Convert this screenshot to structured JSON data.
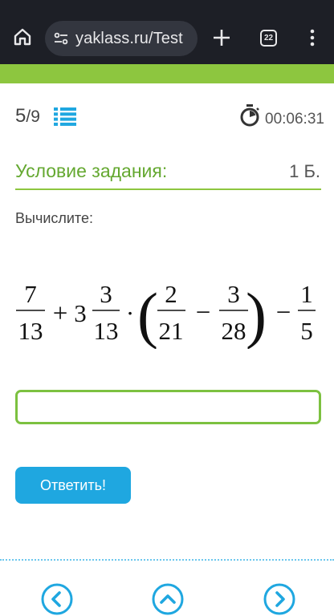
{
  "browser": {
    "url": "yaklass.ru/Test",
    "tab_count": "22",
    "icons": [
      "home-icon",
      "site-settings-icon",
      "plus-icon",
      "tabs-icon",
      "more-vert-icon"
    ]
  },
  "header": {
    "current": "5",
    "total": "/9",
    "timer": "00:06:31"
  },
  "task": {
    "title": "Условие задания:",
    "points": "1 Б.",
    "instruction": "Вычислите:",
    "formula": {
      "frac1_num": "7",
      "frac1_den": "13",
      "plus": "+",
      "whole": "3",
      "frac2_num": "3",
      "frac2_den": "13",
      "dot": "·",
      "paren_open": "(",
      "frac3_num": "2",
      "frac3_den": "21",
      "minus1": "−",
      "frac4_num": "3",
      "frac4_den": "28",
      "paren_close": ")",
      "minus2": "−",
      "frac5_num": "1",
      "frac5_den": "5"
    }
  },
  "answer": {
    "value": "",
    "placeholder": ""
  },
  "submit_label": "Ответить!",
  "colors": {
    "brand_green": "#8dc63f",
    "title_green": "#64a830",
    "button_blue": "#1fa7e0",
    "nav_blue": "#1fa7e0"
  }
}
